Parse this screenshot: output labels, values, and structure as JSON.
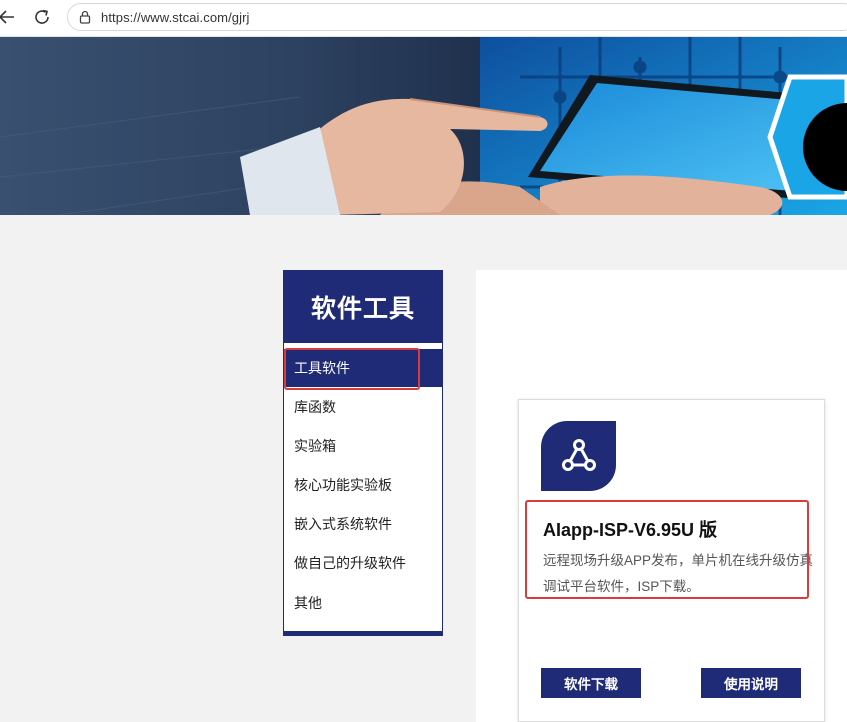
{
  "browser": {
    "url": "https://www.stcai.com/gjrj",
    "back_icon": "arrow-left-icon",
    "reload_icon": "reload-icon",
    "lock_icon": "lock-icon"
  },
  "banner": {
    "description_hidden": ""
  },
  "sidebar": {
    "title": "软件工具",
    "items": [
      {
        "label": "工具软件",
        "active": true
      },
      {
        "label": "库函数",
        "active": false
      },
      {
        "label": "实验箱",
        "active": false
      },
      {
        "label": "核心功能实验板",
        "active": false
      },
      {
        "label": "嵌入式系统软件",
        "active": false
      },
      {
        "label": "做自己的升级软件",
        "active": false
      },
      {
        "label": "其他",
        "active": false
      }
    ]
  },
  "card": {
    "icon": "share-network-icon",
    "title": "AIapp-ISP-V6.95U 版",
    "description": "远程现场升级APP发布，单片机在线升级仿真调试平台软件，ISP下载。",
    "download_label": "软件下载",
    "manual_label": "使用说明"
  },
  "colors": {
    "brand": "#1f2b77",
    "highlight": "#d93c3c"
  }
}
